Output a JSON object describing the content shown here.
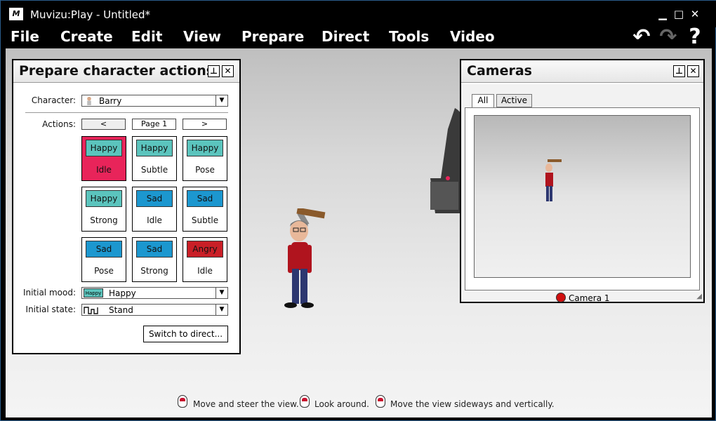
{
  "window": {
    "title": "Muvizu:Play - Untitled*",
    "app_icon": "M",
    "controls": {
      "minimize": "▁",
      "maximize": "□",
      "close": "✕"
    }
  },
  "menu": [
    "File",
    "Create",
    "Edit",
    "View",
    "Prepare",
    "Direct",
    "Tools",
    "Video"
  ],
  "toolbar": {
    "undo": "↶",
    "redo": "↷",
    "help": "?"
  },
  "prepare_panel": {
    "title": "Prepare character actions",
    "character_label": "Character:",
    "character_value": "Barry",
    "actions_label": "Actions:",
    "prev_label": "<",
    "page_label": "Page 1",
    "next_label": ">",
    "actions": [
      {
        "mood": "Happy",
        "name": "Idle",
        "color": "happy",
        "selected": true
      },
      {
        "mood": "Happy",
        "name": "Subtle",
        "color": "happy",
        "selected": false
      },
      {
        "mood": "Happy",
        "name": "Pose",
        "color": "happy",
        "selected": false
      },
      {
        "mood": "Happy",
        "name": "Strong",
        "color": "happy",
        "selected": false
      },
      {
        "mood": "Sad",
        "name": "Idle",
        "color": "sad",
        "selected": false
      },
      {
        "mood": "Sad",
        "name": "Subtle",
        "color": "sad",
        "selected": false
      },
      {
        "mood": "Sad",
        "name": "Pose",
        "color": "sad",
        "selected": false
      },
      {
        "mood": "Sad",
        "name": "Strong",
        "color": "sad",
        "selected": false
      },
      {
        "mood": "Angry",
        "name": "Idle",
        "color": "angry",
        "selected": false
      }
    ],
    "initial_mood_label": "Initial mood:",
    "initial_mood_badge": "Happy",
    "initial_mood_value": "Happy",
    "initial_state_label": "Initial state:",
    "initial_state_value": "Stand",
    "switch_button": "Switch to direct..."
  },
  "cameras_panel": {
    "title": "Cameras",
    "tabs": [
      "All",
      "Active"
    ],
    "active_tab": "All",
    "camera_name": "Camera 1"
  },
  "hints": [
    "Move and steer the view.",
    "Look around.",
    "Move the view sideways and vertically."
  ],
  "colors": {
    "selected": "#e8245a",
    "happy": "#5bc4bd",
    "sad": "#1c97cf",
    "angry": "#c91f27",
    "camera_dot": "#d01010"
  }
}
